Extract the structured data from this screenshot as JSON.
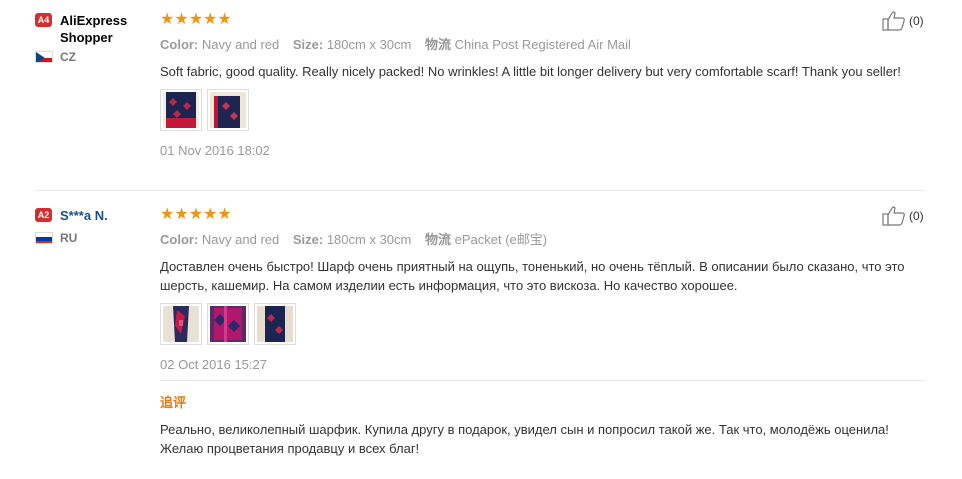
{
  "reviews": [
    {
      "level": "A4",
      "username": "AliExpress Shopper",
      "country": "CZ",
      "rating": 5,
      "stars": "★★★★★",
      "color_label": "Color:",
      "color_value": "Navy and red",
      "size_label": "Size:",
      "size_value": "180cm x 30cm",
      "shipping_label": "物流",
      "shipping_value": "China Post Registered Air Mail",
      "text": "Soft fabric, good quality. Really nicely packed! No wrinkles! A little bit longer delivery but very comfortable scarf! Thank you seller!",
      "photos": [
        "photo-1",
        "photo-2"
      ],
      "date": "01 Nov 2016 18:02",
      "helpful_count": "(0)"
    },
    {
      "level": "A2",
      "username": "S***a N.",
      "country": "RU",
      "rating": 5,
      "stars": "★★★★★",
      "color_label": "Color:",
      "color_value": "Navy and red",
      "size_label": "Size:",
      "size_value": "180cm x 30cm",
      "shipping_label": "物流",
      "shipping_value": "ePacket (e邮宝)",
      "text": "Доставлен очень быстро! Шарф очень приятный на ощупь, тоненький, но очень тёплый. В описании было сказано, что это шерсть, кашемир. На самом изделии есть информация, что это вискоза. Но качество хорошее.",
      "photos": [
        "photo-1",
        "photo-2",
        "photo-3"
      ],
      "date": "02 Oct 2016 15:27",
      "helpful_count": "(0)",
      "followup_label": "追评",
      "followup_text": "Реально, великолепный шарфик. Купила другу в подарок, увидел сын и попросил такой же. Так что, молодёжь оценила! Желаю процветания продавцу и всех благ!"
    }
  ],
  "colors": {
    "star": "#f09512",
    "badge": "#d62d2d",
    "followup": "#e47911",
    "meta": "#999999"
  },
  "icons": {
    "helpful": "thumbs-up-icon",
    "flag_cz": "czech-flag-icon",
    "flag_ru": "russian-flag-icon"
  }
}
